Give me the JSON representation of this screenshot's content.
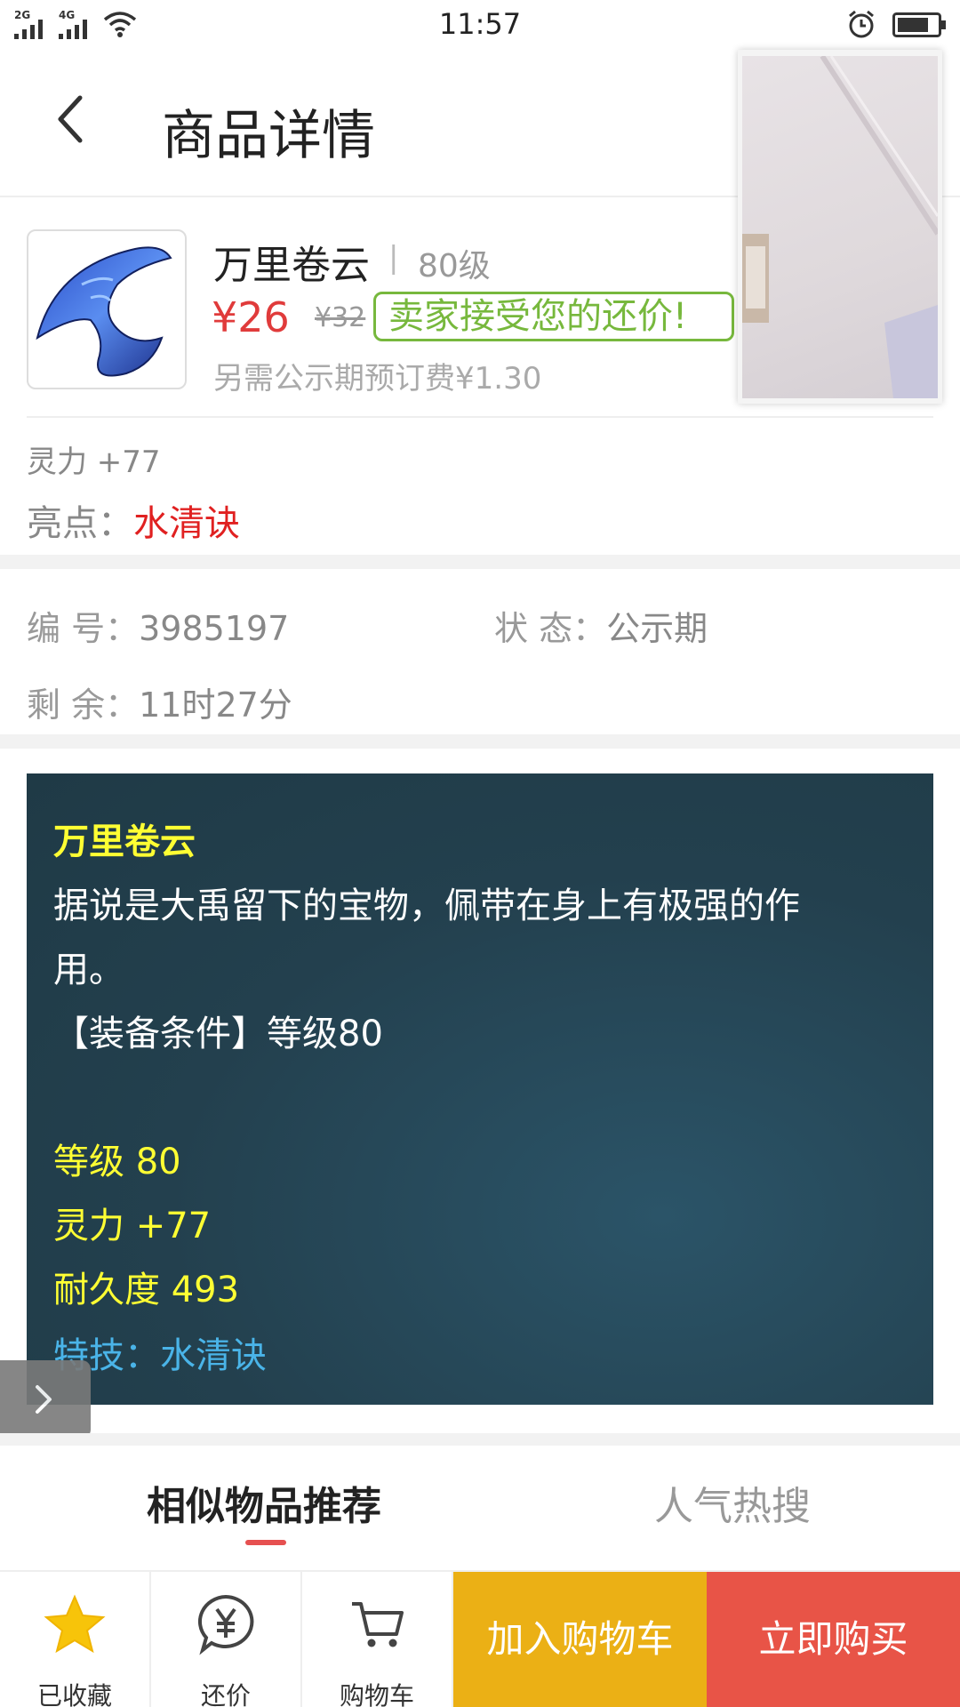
{
  "status_bar": {
    "time": "11:57",
    "net1": "2G",
    "net2": "4G"
  },
  "header": {
    "title": "商品详情"
  },
  "product": {
    "name": "万里卷云",
    "separator": "|",
    "level": "80级",
    "price": "¥26",
    "original_price": "¥32",
    "accept_badge": "卖家接受您的还价!",
    "extra_fee": "另需公示期预订费¥1.30",
    "attribute": "灵力 +77",
    "highlight_label": "亮点：",
    "highlight_value": "水清诀"
  },
  "info": {
    "id_label": "编  号：",
    "id_value": "3985197",
    "status_label": "状  态：",
    "status_value": "公示期",
    "remain_label": "剩  余：",
    "remain_value": "11时27分"
  },
  "description": {
    "title": "万里卷云",
    "line1": "据说是大禹留下的宝物，佩带在身上有极强的作",
    "line2": "用。",
    "line3": "【装备条件】等级80",
    "stat_level": "等级 80",
    "stat_spirit": "灵力 +77",
    "stat_durability": "耐久度 493",
    "skill": "特技：水清诀"
  },
  "tabs": {
    "similar": "相似物品推荐",
    "popular": "人气热搜"
  },
  "bottom_bar": {
    "favorite": "已收藏",
    "counter_offer": "还价",
    "cart": "购物车",
    "add_to_cart": "加入购物车",
    "buy_now": "立即购买"
  },
  "colors": {
    "price_red": "#e03b3b",
    "accept_green": "#77b83d",
    "cart_yellow": "#ebb015",
    "buy_red": "#e85447",
    "panel_bg": "#23404e",
    "desc_yellow": "#ffff33",
    "skill_blue": "#4ab4e8"
  },
  "icons": {
    "back": "chevron-left-icon",
    "favorite": "star-icon",
    "counter_offer": "yen-bubble-icon",
    "cart": "cart-icon",
    "side_handle": "chevron-right-icon",
    "alarm": "alarm-icon",
    "battery": "battery-icon",
    "wifi": "wifi-icon"
  }
}
